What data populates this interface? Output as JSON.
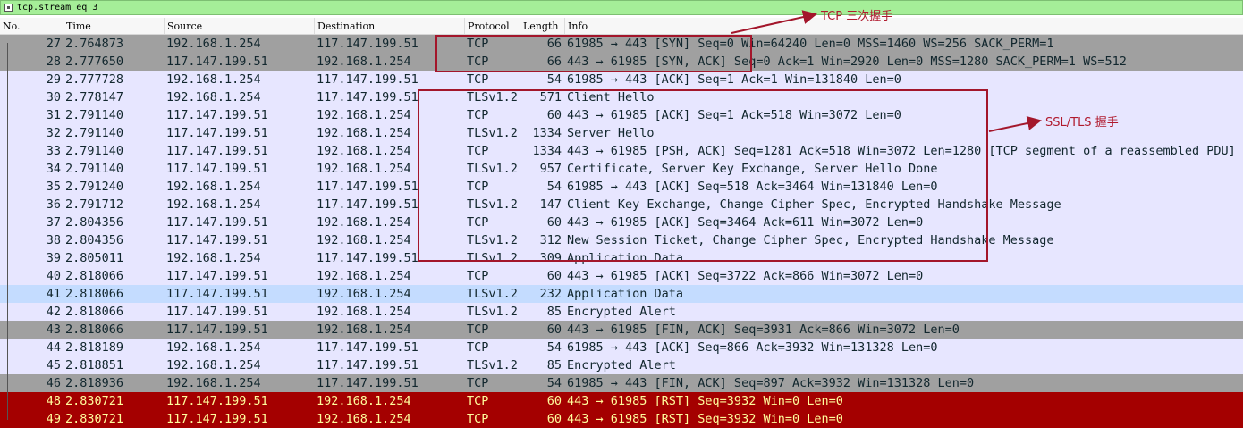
{
  "filter": {
    "value": "tcp.stream eq 3"
  },
  "columns": {
    "no": "No.",
    "time": "Time",
    "source": "Source",
    "destination": "Destination",
    "protocol": "Protocol",
    "length": "Length",
    "info": "Info"
  },
  "colors": {
    "gray_row": "#a0a0a0",
    "lavender_row": "#e7e6ff",
    "selected_row": "#c4dcff",
    "rst_row": "#a40000",
    "rst_text": "#fffc9c",
    "annotation": "#a3162b"
  },
  "packets": [
    {
      "no": "27",
      "time": "2.764873",
      "source": "192.168.1.254",
      "destination": "117.147.199.51",
      "protocol": "TCP",
      "length": "66",
      "info": "61985 → 443 [SYN] Seq=0 Win=64240 Len=0 MSS=1460 WS=256 SACK_PERM=1",
      "style": "gray"
    },
    {
      "no": "28",
      "time": "2.777650",
      "source": "117.147.199.51",
      "destination": "192.168.1.254",
      "protocol": "TCP",
      "length": "66",
      "info": "443 → 61985 [SYN, ACK] Seq=0 Ack=1 Win=2920 Len=0 MSS=1280 SACK_PERM=1 WS=512",
      "style": "gray"
    },
    {
      "no": "29",
      "time": "2.777728",
      "source": "192.168.1.254",
      "destination": "117.147.199.51",
      "protocol": "TCP",
      "length": "54",
      "info": "61985 → 443 [ACK] Seq=1 Ack=1 Win=131840 Len=0",
      "style": "lavender"
    },
    {
      "no": "30",
      "time": "2.778147",
      "source": "192.168.1.254",
      "destination": "117.147.199.51",
      "protocol": "TLSv1.2",
      "length": "571",
      "info": "Client Hello",
      "style": "lavender"
    },
    {
      "no": "31",
      "time": "2.791140",
      "source": "117.147.199.51",
      "destination": "192.168.1.254",
      "protocol": "TCP",
      "length": "60",
      "info": "443 → 61985 [ACK] Seq=1 Ack=518 Win=3072 Len=0",
      "style": "lavender"
    },
    {
      "no": "32",
      "time": "2.791140",
      "source": "117.147.199.51",
      "destination": "192.168.1.254",
      "protocol": "TLSv1.2",
      "length": "1334",
      "info": "Server Hello",
      "style": "lavender"
    },
    {
      "no": "33",
      "time": "2.791140",
      "source": "117.147.199.51",
      "destination": "192.168.1.254",
      "protocol": "TCP",
      "length": "1334",
      "info": "443 → 61985 [PSH, ACK] Seq=1281 Ack=518 Win=3072 Len=1280 [TCP segment of a reassembled PDU]",
      "style": "lavender"
    },
    {
      "no": "34",
      "time": "2.791140",
      "source": "117.147.199.51",
      "destination": "192.168.1.254",
      "protocol": "TLSv1.2",
      "length": "957",
      "info": "Certificate, Server Key Exchange, Server Hello Done",
      "style": "lavender"
    },
    {
      "no": "35",
      "time": "2.791240",
      "source": "192.168.1.254",
      "destination": "117.147.199.51",
      "protocol": "TCP",
      "length": "54",
      "info": "61985 → 443 [ACK] Seq=518 Ack=3464 Win=131840 Len=0",
      "style": "lavender"
    },
    {
      "no": "36",
      "time": "2.791712",
      "source": "192.168.1.254",
      "destination": "117.147.199.51",
      "protocol": "TLSv1.2",
      "length": "147",
      "info": "Client Key Exchange, Change Cipher Spec, Encrypted Handshake Message",
      "style": "lavender"
    },
    {
      "no": "37",
      "time": "2.804356",
      "source": "117.147.199.51",
      "destination": "192.168.1.254",
      "protocol": "TCP",
      "length": "60",
      "info": "443 → 61985 [ACK] Seq=3464 Ack=611 Win=3072 Len=0",
      "style": "lavender"
    },
    {
      "no": "38",
      "time": "2.804356",
      "source": "117.147.199.51",
      "destination": "192.168.1.254",
      "protocol": "TLSv1.2",
      "length": "312",
      "info": "New Session Ticket, Change Cipher Spec, Encrypted Handshake Message",
      "style": "lavender"
    },
    {
      "no": "39",
      "time": "2.805011",
      "source": "192.168.1.254",
      "destination": "117.147.199.51",
      "protocol": "TLSv1.2",
      "length": "309",
      "info": "Application Data",
      "style": "lavender"
    },
    {
      "no": "40",
      "time": "2.818066",
      "source": "117.147.199.51",
      "destination": "192.168.1.254",
      "protocol": "TCP",
      "length": "60",
      "info": "443 → 61985 [ACK] Seq=3722 Ack=866 Win=3072 Len=0",
      "style": "lavender"
    },
    {
      "no": "41",
      "time": "2.818066",
      "source": "117.147.199.51",
      "destination": "192.168.1.254",
      "protocol": "TLSv1.2",
      "length": "232",
      "info": "Application Data",
      "style": "selected"
    },
    {
      "no": "42",
      "time": "2.818066",
      "source": "117.147.199.51",
      "destination": "192.168.1.254",
      "protocol": "TLSv1.2",
      "length": "85",
      "info": "Encrypted Alert",
      "style": "lavender"
    },
    {
      "no": "43",
      "time": "2.818066",
      "source": "117.147.199.51",
      "destination": "192.168.1.254",
      "protocol": "TCP",
      "length": "60",
      "info": "443 → 61985 [FIN, ACK] Seq=3931 Ack=866 Win=3072 Len=0",
      "style": "gray"
    },
    {
      "no": "44",
      "time": "2.818189",
      "source": "192.168.1.254",
      "destination": "117.147.199.51",
      "protocol": "TCP",
      "length": "54",
      "info": "61985 → 443 [ACK] Seq=866 Ack=3932 Win=131328 Len=0",
      "style": "lavender"
    },
    {
      "no": "45",
      "time": "2.818851",
      "source": "192.168.1.254",
      "destination": "117.147.199.51",
      "protocol": "TLSv1.2",
      "length": "85",
      "info": "Encrypted Alert",
      "style": "lavender"
    },
    {
      "no": "46",
      "time": "2.818936",
      "source": "192.168.1.254",
      "destination": "117.147.199.51",
      "protocol": "TCP",
      "length": "54",
      "info": "61985 → 443 [FIN, ACK] Seq=897 Ack=3932 Win=131328 Len=0",
      "style": "gray"
    },
    {
      "no": "48",
      "time": "2.830721",
      "source": "117.147.199.51",
      "destination": "192.168.1.254",
      "protocol": "TCP",
      "length": "60",
      "info": "443 → 61985 [RST] Seq=3932 Win=0 Len=0",
      "style": "rst"
    },
    {
      "no": "49",
      "time": "2.830721",
      "source": "117.147.199.51",
      "destination": "192.168.1.254",
      "protocol": "TCP",
      "length": "60",
      "info": "443 → 61985 [RST] Seq=3932 Win=0 Len=0",
      "style": "rst"
    }
  ],
  "annotations": {
    "tcp_handshake": "TCP 三次握手",
    "tls_handshake": "SSL/TLS 握手"
  }
}
